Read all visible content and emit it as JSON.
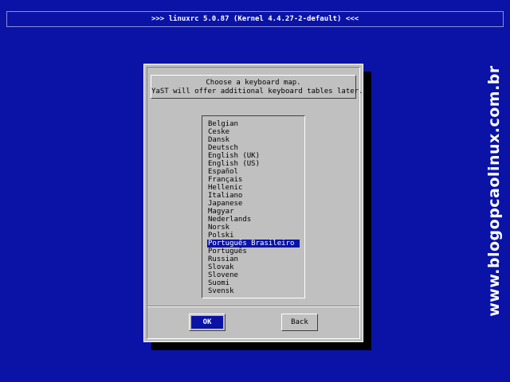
{
  "header": {
    "title": ">>> linuxrc 5.0.87 (Kernel 4.4.27-2-default) <<<"
  },
  "dialog": {
    "message_lines": [
      "Choose a keyboard map.",
      "YaST will offer additional keyboard tables later."
    ],
    "keyboard_maps": [
      "Belgian",
      "Ceske",
      "Dansk",
      "Deutsch",
      "English (UK)",
      "English (US)",
      "Español",
      "Français",
      "Hellenic",
      "Italiano",
      "Japanese",
      "Magyar",
      "Nederlands",
      "Norsk",
      "Polski",
      "Português Brasileiro",
      "Português",
      "Russian",
      "Slovak",
      "Slovene",
      "Suomi",
      "Svensk"
    ],
    "selected_map": "Português Brasileiro",
    "ok_label": "OK",
    "back_label": "Back"
  },
  "watermark": "www.blogopcaolinux.com.br",
  "colors": {
    "background": "#0a13a6",
    "dialog": "#c0c0c0",
    "selection": "#0a13a6"
  }
}
